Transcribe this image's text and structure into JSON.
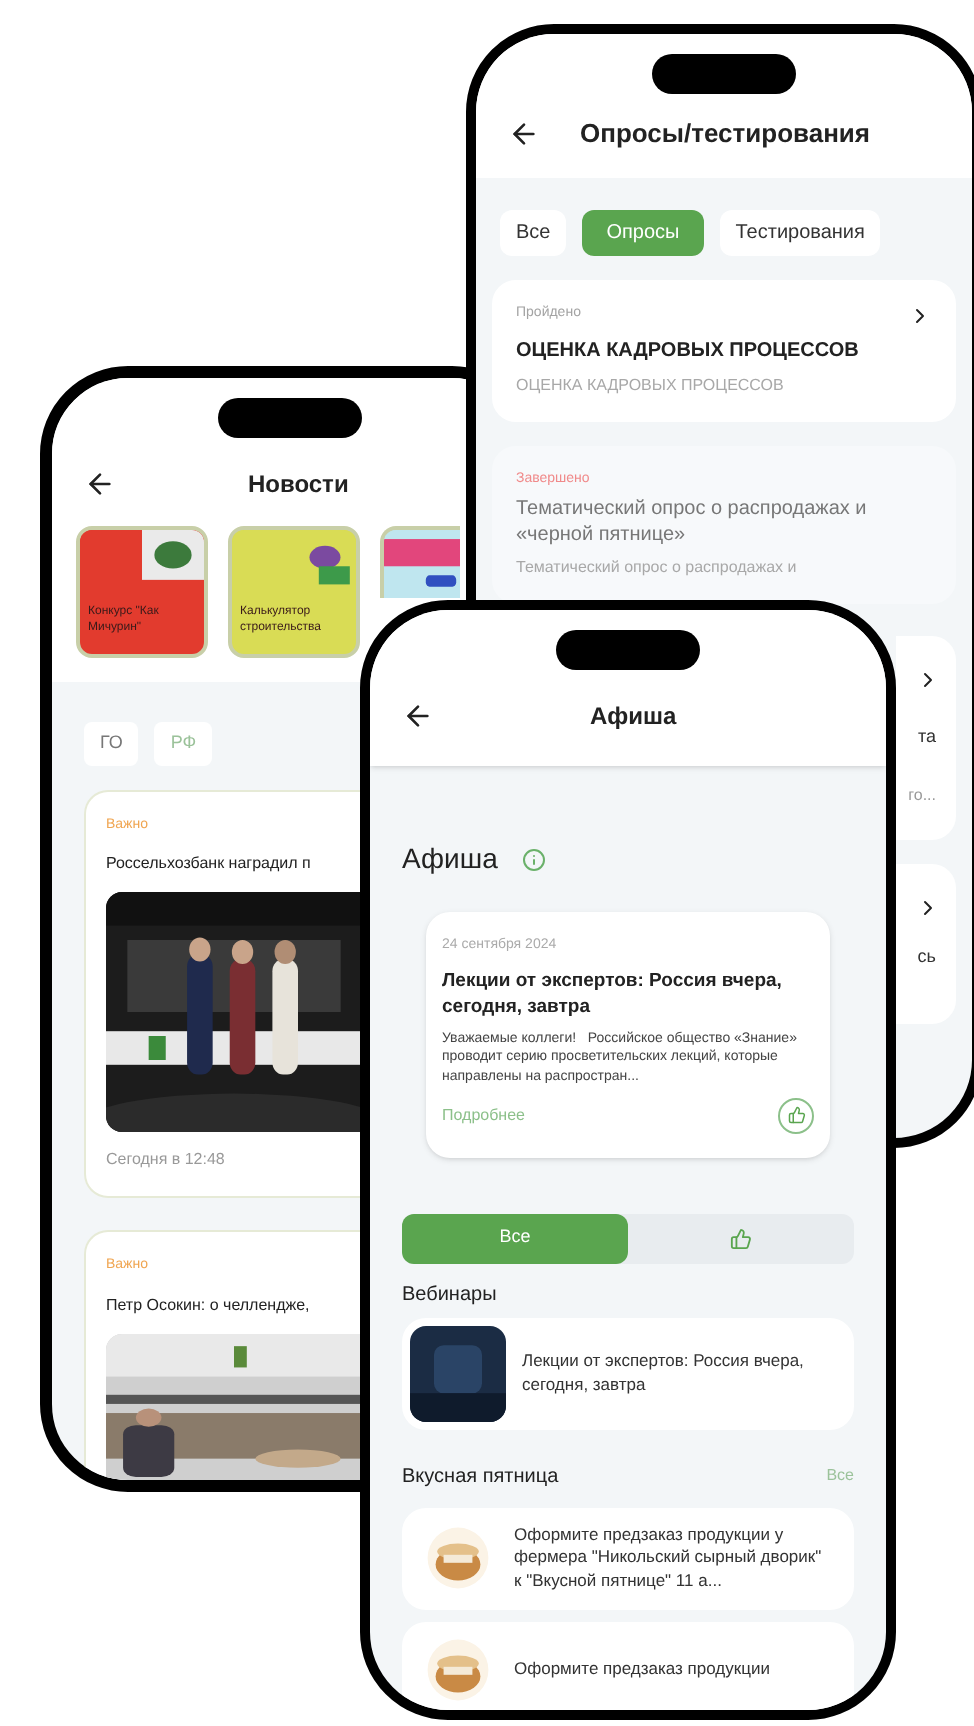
{
  "surveys_phone": {
    "title": "Опросы/тестирования",
    "tabs": [
      {
        "label": "Все",
        "selected": false
      },
      {
        "label": "Опросы",
        "selected": true
      },
      {
        "label": "Тестирования",
        "selected": false
      }
    ],
    "cards": [
      {
        "status": "Пройдено",
        "color": "#a3a3a3",
        "title": "ОЦЕНКА КАДРОВЫХ ПРОЦЕССОВ",
        "subtitle": "ОЦЕНКА КАДРОВЫХ ПРОЦЕССОВ",
        "highlighted": true
      },
      {
        "status": "Завершено",
        "color": "#f08a8a",
        "title": "Тематический опрос о распродажах и «черной пятнице»",
        "subtitle": "Тематический опрос о распродажах и",
        "highlighted": false
      }
    ],
    "partial_cards": [
      {
        "fragments": [
          "та",
          "го..."
        ]
      },
      {
        "fragments": [
          "сь"
        ]
      }
    ]
  },
  "news_phone": {
    "title": "Новости",
    "stories": [
      {
        "caption": "Конкурс \"Как Мичурин\"",
        "color": "#e23b2e"
      },
      {
        "caption": "Калькулятор строительства",
        "color": "#d9dc55"
      },
      {
        "color": "#bfe6ef"
      }
    ],
    "filters": [
      {
        "label": "ГО"
      },
      {
        "label": "РФ"
      }
    ],
    "news": [
      {
        "tag": "Важно",
        "title": "Россельхозбанк наградил п",
        "time": "Сегодня в 12:48"
      },
      {
        "tag": "Важно",
        "title": "Петр Осокин: о челлендже,"
      }
    ]
  },
  "afisha_phone": {
    "title": "Афиша",
    "section_title": "Афиша",
    "event": {
      "date": "24 сентября 2024",
      "title": "Лекции от экспертов: Россия вчера, сегодня, завтра",
      "text": "Уважаемые коллеги!   Российское общество «Знание» проводит серию просветительских лекций, которые направлены на распростран...",
      "link": "Подробнее"
    },
    "segments": [
      {
        "kind": "text",
        "label": "Все",
        "selected": true
      },
      {
        "kind": "like",
        "selected": false
      }
    ],
    "webinars": {
      "title": "Вебинары",
      "items": [
        {
          "title": "Лекции от экспертов: Россия вчера, сегодня, завтра"
        }
      ]
    },
    "tasty_friday": {
      "title": "Вкусная пятница",
      "action": "Все",
      "items": [
        {
          "text": "Оформите предзаказ продукции у фермера \"Никольский сырный дворик\" к \"Вкусной пятнице\" 11 а..."
        },
        {
          "text": "Оформите предзаказ продукции"
        }
      ]
    }
  }
}
